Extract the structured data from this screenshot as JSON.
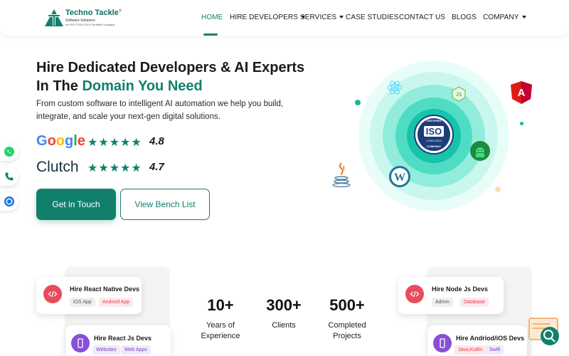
{
  "header": {
    "logo": {
      "name": "Techno Tackle",
      "sub1": "Software Solutions",
      "sub2": "An ISO 27001:2013 Certified Company"
    },
    "nav": [
      {
        "label": "HOME",
        "active": true,
        "dropdown": false
      },
      {
        "label": "HIRE DEVELOPERS",
        "active": false,
        "dropdown": true
      },
      {
        "label": "SERVICES",
        "active": false,
        "dropdown": true
      },
      {
        "label": "CASE STUDIES",
        "active": false,
        "dropdown": false
      },
      {
        "label": "CONTACT US",
        "active": false,
        "dropdown": false
      },
      {
        "label": "BLOGS",
        "active": false,
        "dropdown": false
      },
      {
        "label": "COMPANY",
        "active": false,
        "dropdown": true
      }
    ]
  },
  "hero": {
    "title_line1": "Hire Dedicated Developers & AI Experts",
    "title_line2_prefix": "In The ",
    "title_line2_accent": "Domain You Need",
    "description": "From custom software to intelligent AI automation we help you build, integrate, and scale your next-gen digital solutions.",
    "ratings": [
      {
        "brand": "Google",
        "stars": "★★★★★",
        "value": "4.8"
      },
      {
        "brand": "Clutch",
        "stars": "★★★★★",
        "value": "4.7"
      }
    ],
    "primary_button": "Get in Touch",
    "secondary_button": "View Bench List",
    "badge": {
      "top": "CERTIFIED",
      "main": "ISO",
      "code": "27001:2013",
      "bottom": "COMPANY"
    }
  },
  "stats": [
    {
      "value": "10+",
      "label_line1": "Years of",
      "label_line2": "Experience"
    },
    {
      "value": "300+",
      "label_line1": "Clients",
      "label_line2": ""
    },
    {
      "value": "500+",
      "label_line1": "Completed",
      "label_line2": "Projects"
    }
  ],
  "dev_cards": [
    {
      "title": "Hire React Native Devs",
      "tags": [
        "iOS App",
        "Android App"
      ]
    },
    {
      "title": "Hire  React Js Devs",
      "tags": [
        "Websites",
        "Web Apps"
      ]
    },
    {
      "title": "Hire  Node Js Devs",
      "tags": [
        "Admin",
        "Database"
      ]
    },
    {
      "title": "Hire  Andriod/iOS Devs",
      "tags": [
        "Java,Kotlin",
        "Swift"
      ]
    }
  ],
  "colors": {
    "brand": "#10806d",
    "text": "#1a1a1a",
    "accent_red": "#e94b5b",
    "accent_purple": "#8a4fd6"
  }
}
